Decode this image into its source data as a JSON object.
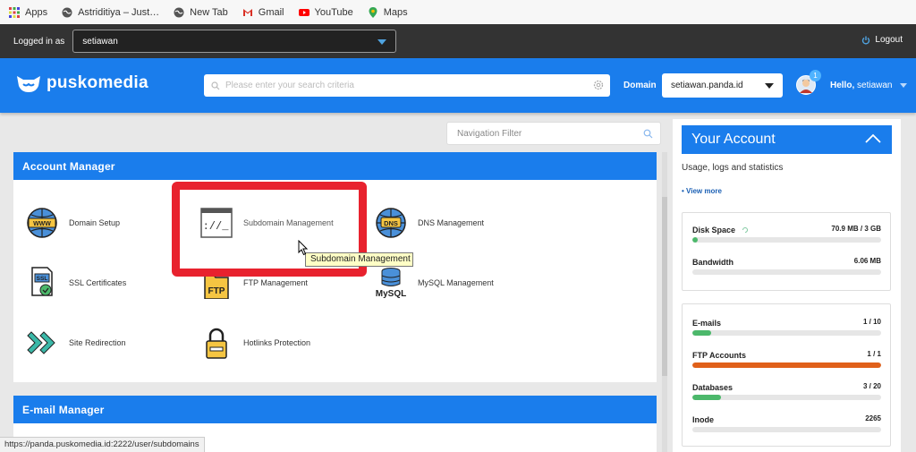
{
  "bookmarks": [
    {
      "label": "Apps",
      "icon": "apps-grid-icon"
    },
    {
      "label": "Astriditiya – Just…",
      "icon": "globe-icon"
    },
    {
      "label": "New Tab",
      "icon": "globe-icon"
    },
    {
      "label": "Gmail",
      "icon": "gmail-icon"
    },
    {
      "label": "YouTube",
      "icon": "youtube-icon"
    },
    {
      "label": "Maps",
      "icon": "maps-icon"
    }
  ],
  "login_bar": {
    "label": "Logged in as",
    "user": "setiawan",
    "logout": "Logout"
  },
  "header": {
    "logo": "puskomedia",
    "search_placeholder": "Please enter your search criteria",
    "domain_label": "Domain",
    "domain_value": "setiawan.panda.id",
    "notification_count": "1",
    "hello": "Hello,",
    "username": "setiawan"
  },
  "nav_filter_placeholder": "Navigation Filter",
  "account_manager": {
    "title": "Account Manager",
    "items": [
      {
        "label": "Domain Setup",
        "icon": "www-globe-icon"
      },
      {
        "label": "Subdomain Management",
        "icon": "terminal-window-icon"
      },
      {
        "label": "DNS Management",
        "icon": "dns-globe-icon"
      },
      {
        "label": "SSL Certificates",
        "icon": "ssl-certificate-icon"
      },
      {
        "label": "FTP Management",
        "icon": "ftp-folder-icon"
      },
      {
        "label": "MySQL Management",
        "icon": "mysql-database-icon"
      },
      {
        "label": "Site Redirection",
        "icon": "redirect-arrows-icon"
      },
      {
        "label": "Hotlinks Protection",
        "icon": "padlock-icon"
      }
    ]
  },
  "email_manager": {
    "title": "E-mail Manager"
  },
  "tooltip": "Subdomain Management",
  "status_url": "https://panda.puskomedia.id:2222/user/subdomains",
  "your_account": {
    "title": "Your Account",
    "subtitle": "Usage, logs and statistics",
    "view_more": "• View more",
    "stats": [
      {
        "name": "Disk Space",
        "value": "70.9 MB / 3 GB",
        "fraction": 0.023,
        "color": "#4cb86b"
      },
      {
        "name": "Bandwidth",
        "value": "6.06 MB",
        "fraction": 0.0,
        "color": "#4cb86b"
      },
      {
        "name": "E-mails",
        "value": "1 / 10",
        "fraction": 0.1,
        "color": "#4cb86b"
      },
      {
        "name": "FTP Accounts",
        "value": "1 / 1",
        "fraction": 1.0,
        "color": "#e0601a"
      },
      {
        "name": "Databases",
        "value": "3 / 20",
        "fraction": 0.15,
        "color": "#4cb86b"
      },
      {
        "name": "Inode",
        "value": "2265",
        "fraction": 0.0,
        "color": "#4cb86b"
      }
    ]
  },
  "colors": {
    "brand_blue": "#1a7dec",
    "highlight_red": "#e8222e",
    "dark_bar": "#333333"
  }
}
